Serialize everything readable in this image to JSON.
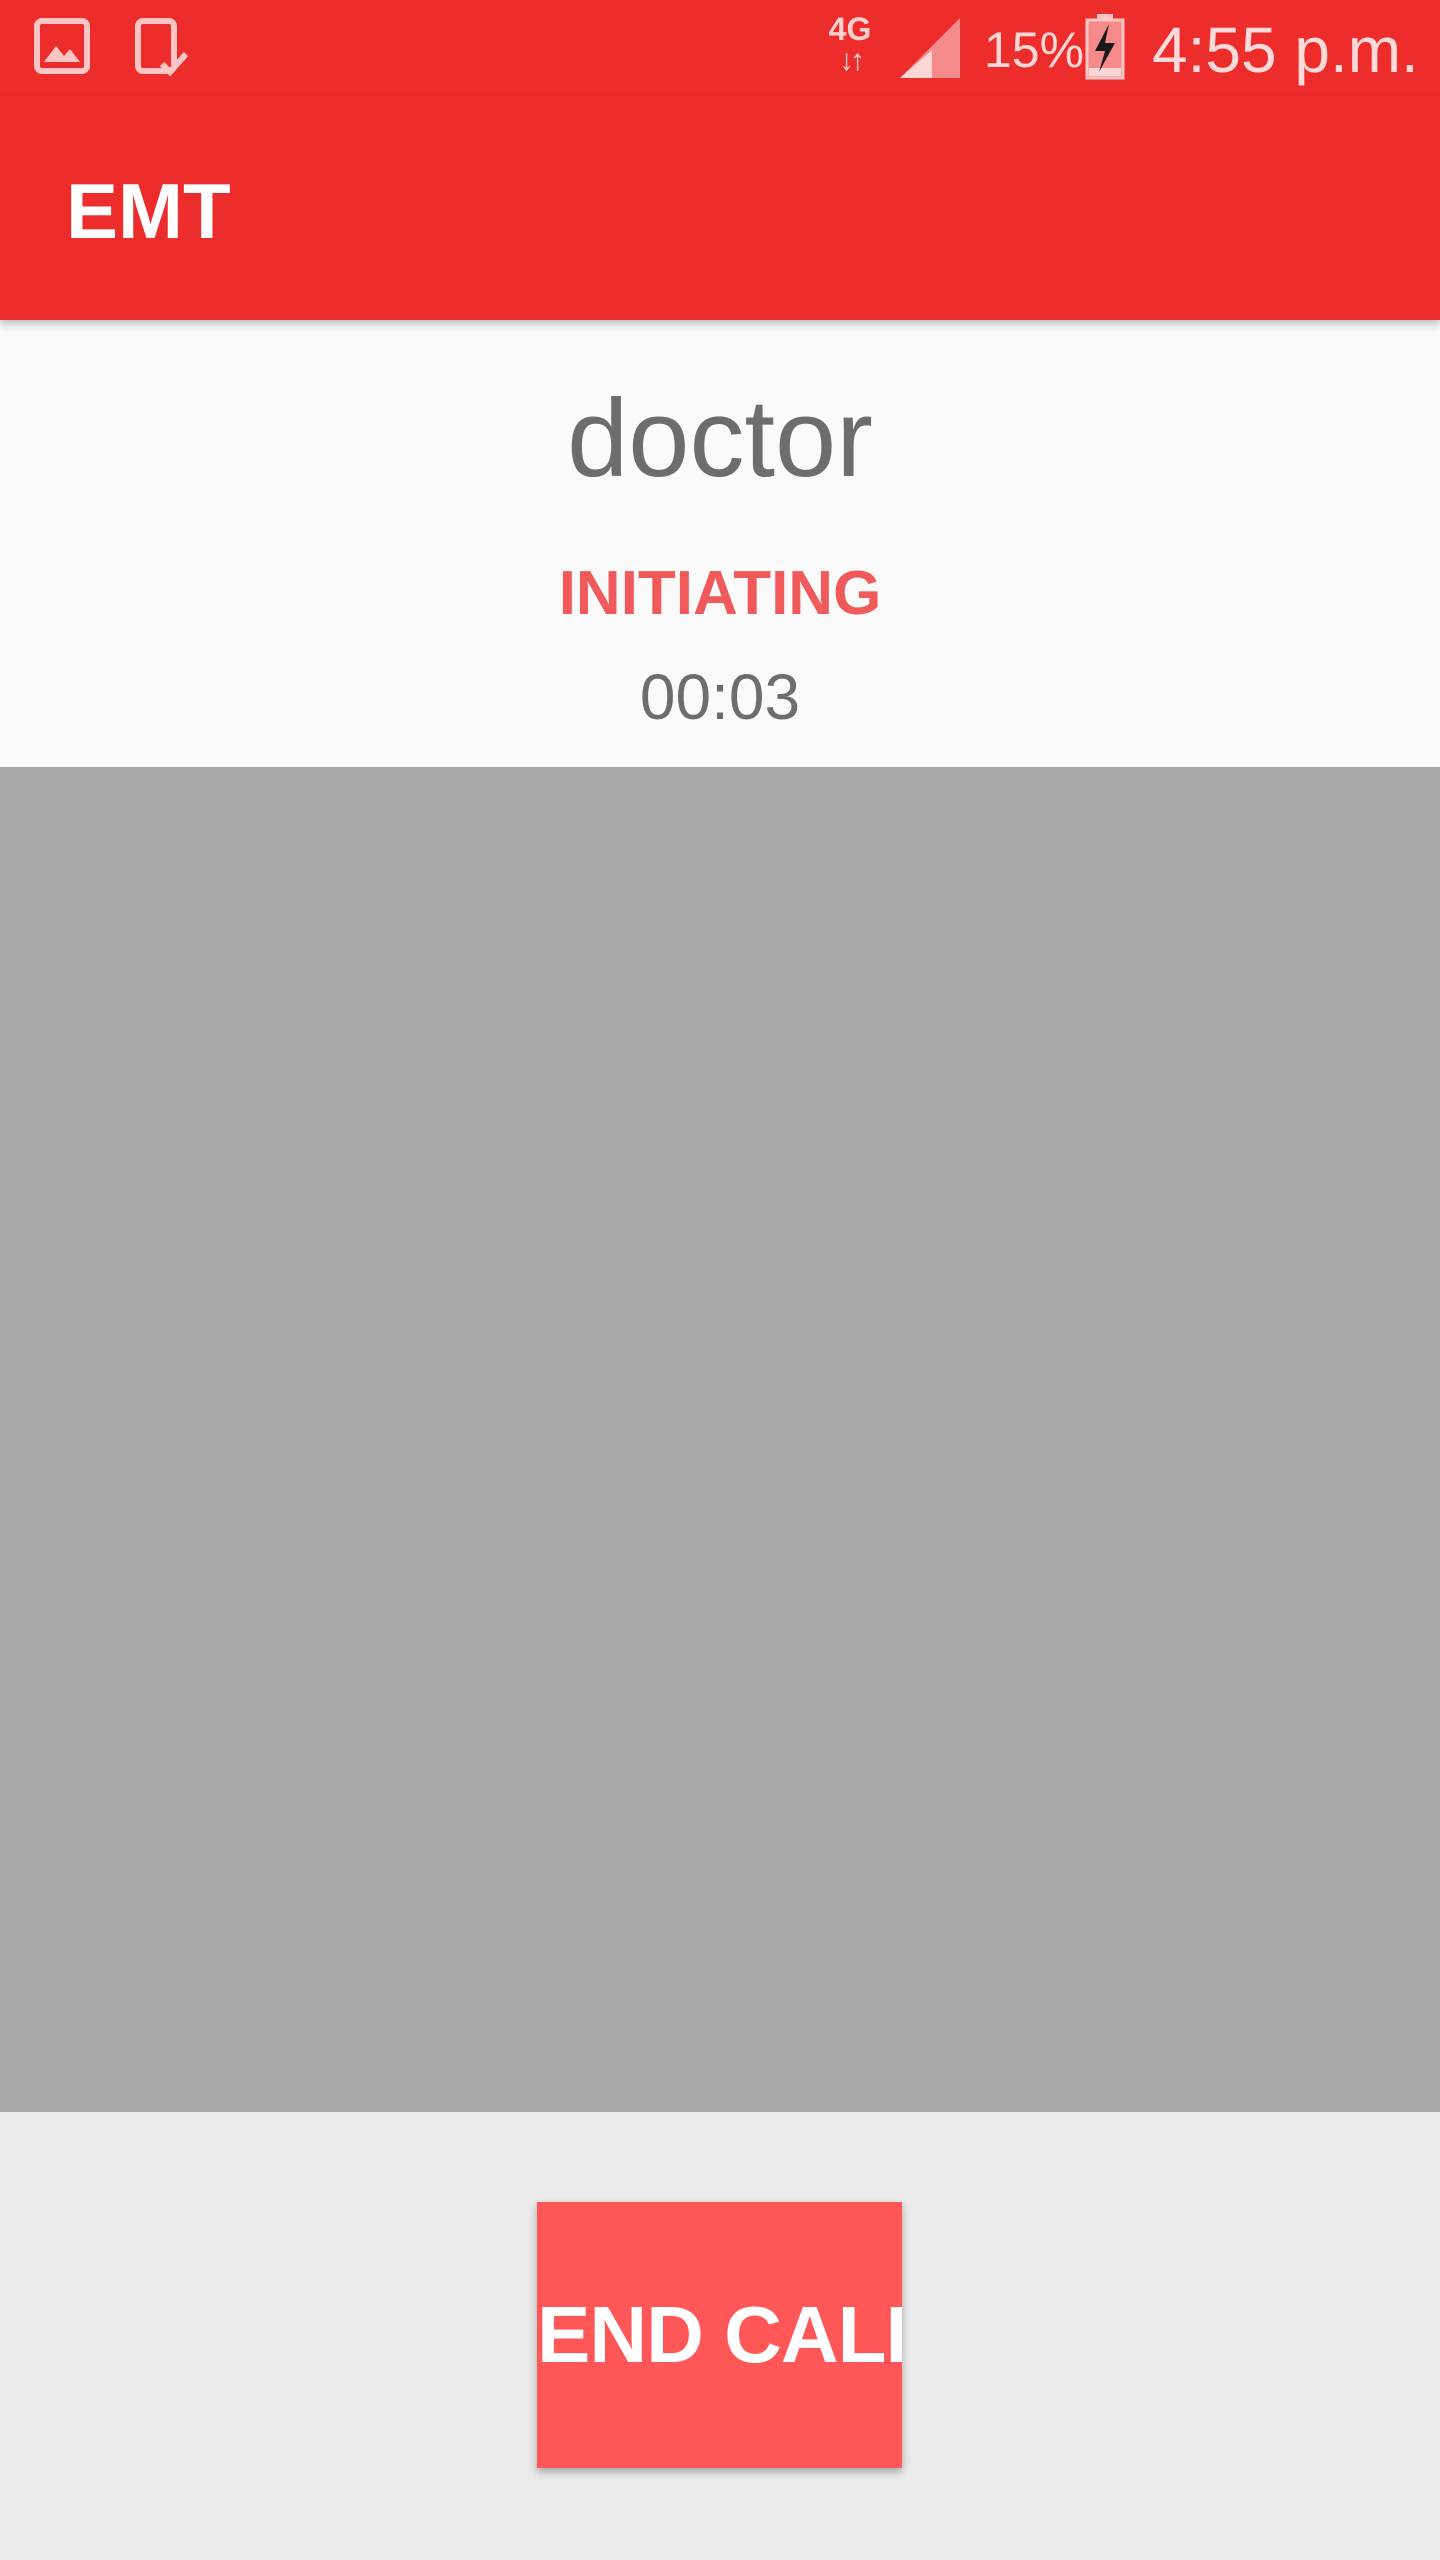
{
  "status_bar": {
    "network_type": "4G",
    "network_arrows": "↓↑",
    "battery_percent": "15%",
    "time": "4:55 p.m.",
    "icons": [
      "gallery-icon",
      "tablet-check-icon",
      "signal-icon",
      "battery-charging-icon"
    ]
  },
  "app_bar": {
    "title": "EMT"
  },
  "call": {
    "callee": "doctor",
    "status": "INITIATING",
    "timer": "00:03"
  },
  "controls": {
    "end_call_label": "END CALL"
  },
  "colors": {
    "primary": "#ed2c2c",
    "accent": "#ff5757",
    "status_text": "#f05a5a",
    "video_placeholder": "#a9a9a9"
  }
}
